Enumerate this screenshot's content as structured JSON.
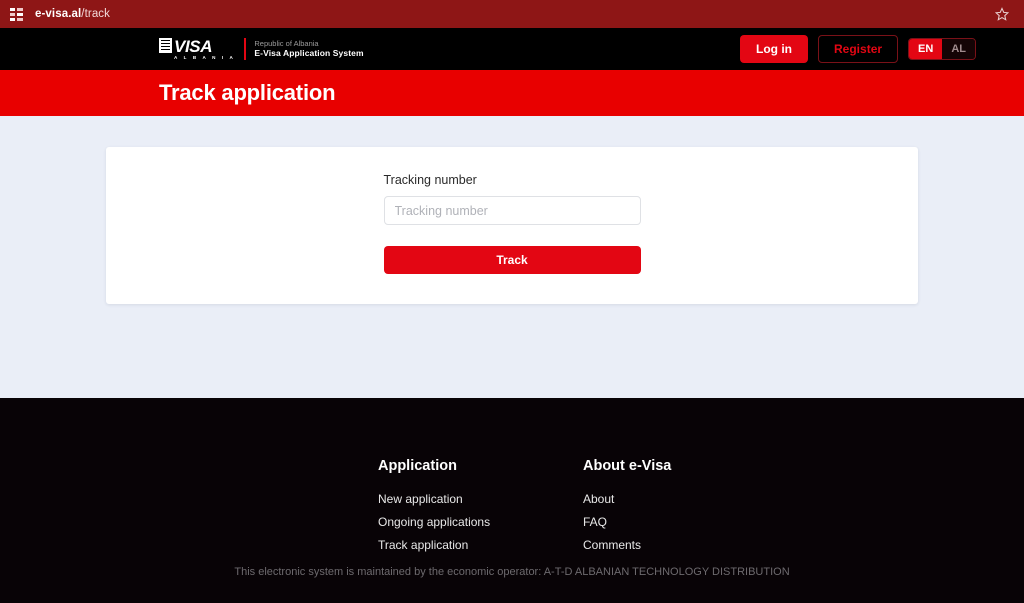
{
  "browser": {
    "favicon_icon": "grid-favicon-icon",
    "url_host": "e-visa.al",
    "url_path": "/track",
    "bookmark_icon": "star-icon"
  },
  "header": {
    "brand": {
      "mark_icon": "document-icon",
      "wordmark": "VISA",
      "country": "A L B A N I A",
      "subtitle_top": "Republic of Albania",
      "subtitle_bottom": "E-Visa Application System"
    },
    "login_label": "Log in",
    "register_label": "Register",
    "languages": [
      {
        "code": "EN",
        "active": true
      },
      {
        "code": "AL",
        "active": false
      }
    ]
  },
  "banner": {
    "title": "Track application"
  },
  "form": {
    "label": "Tracking number",
    "placeholder": "Tracking number",
    "value": "",
    "submit_label": "Track"
  },
  "footer": {
    "columns": [
      {
        "heading": "Application",
        "links": [
          "New application",
          "Ongoing applications",
          "Track application"
        ]
      },
      {
        "heading": "About e-Visa",
        "links": [
          "About",
          "FAQ",
          "Comments"
        ]
      }
    ],
    "note": "This electronic system is maintained by the economic operator: A-T-D ALBANIAN TECHNOLOGY DISTRIBUTION"
  },
  "colors": {
    "brand_red": "#e30613",
    "banner_red": "#e80000",
    "header_black": "#000000",
    "footer_black": "#080306",
    "page_bg": "#eaeef7",
    "browser_bar": "#8d1818"
  }
}
